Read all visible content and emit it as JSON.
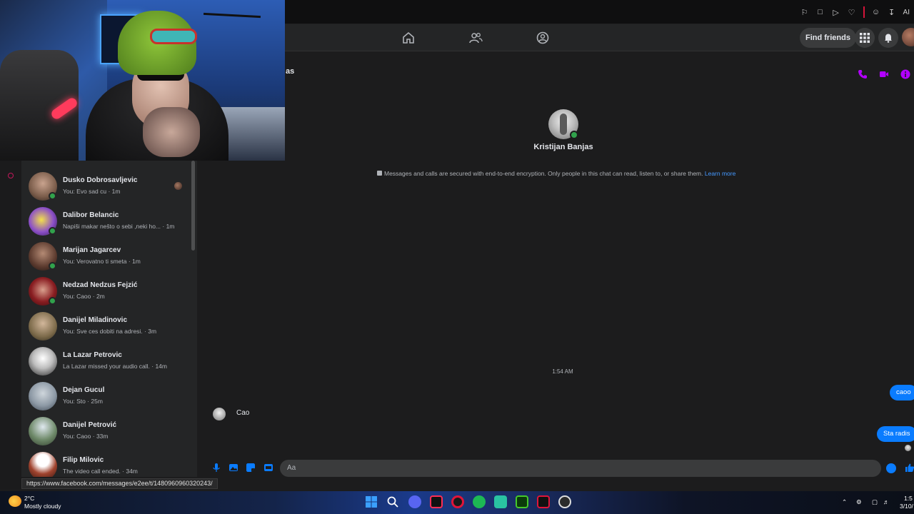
{
  "browser": {
    "top_icons": [
      "pin-icon",
      "tab-icon",
      "play-icon",
      "heart-icon",
      "profile-icon",
      "download-icon",
      "ai-icon"
    ],
    "ai_label": "AI"
  },
  "facebook_nav": {
    "find_friends_label": "Find friends"
  },
  "chat_list": [
    {
      "name": "Dusko Dobrosavljevic",
      "preview": "You: Evo sad cu · 1m",
      "online": true,
      "color": "#7a5c4a"
    },
    {
      "name": "Dalibor Belancic",
      "preview": "Napiši makar nešto o sebi ,neki ho... · 1m",
      "online": true,
      "color": "#8b4fc8"
    },
    {
      "name": "Marijan Jagarcev",
      "preview": "You: Verovatno ti smeta · 1m",
      "online": true,
      "color": "#5b3a2e"
    },
    {
      "name": "Nedzad Nedzus Fejzić",
      "preview": "You: Caoo · 2m",
      "online": true,
      "color": "#8a1e22"
    },
    {
      "name": "Danijel Miladinovic",
      "preview": "You: Sve ces dobiti na adresi. · 3m",
      "online": false,
      "color": "#7c6a4a"
    },
    {
      "name": "La Lazar Petrovic",
      "preview": "La Lazar missed your audio call. · 14m",
      "online": false,
      "color": "#cccccc"
    },
    {
      "name": "Dejan Gucul",
      "preview": "You: Sto · 25m",
      "online": false,
      "color": "#8e9aa6"
    },
    {
      "name": "Danijel Petrović",
      "preview": "You: Caoo · 33m",
      "online": false,
      "color": "#6f8a6a"
    },
    {
      "name": "Filip Milovic",
      "preview": "The video call ended. · 34m",
      "online": false,
      "color": "#ffffff"
    }
  ],
  "conversation": {
    "header_partial": "as",
    "contact_name": "Kristijan Banjas",
    "e2e_text": "Messages and calls are secured with end-to-end encryption. Only people in this chat can read, listen to, or share them.",
    "learn_more": "Learn more",
    "timestamp": "1:54 AM",
    "messages": [
      {
        "from": "me",
        "text": "caoo"
      },
      {
        "from": "them",
        "text": "Cao"
      },
      {
        "from": "me",
        "text": "Sta radis"
      }
    ],
    "composer_placeholder": "Aa",
    "accent_color": "#0a7cff",
    "header_icon_color": "#b200ff"
  },
  "status_url": "https://www.facebook.com/messages/e2ee/t/1480960960320243/",
  "taskbar": {
    "temperature": "2°C",
    "weather": "Mostly cloudy",
    "clock_time": "1:5",
    "clock_date": "3/10/"
  }
}
